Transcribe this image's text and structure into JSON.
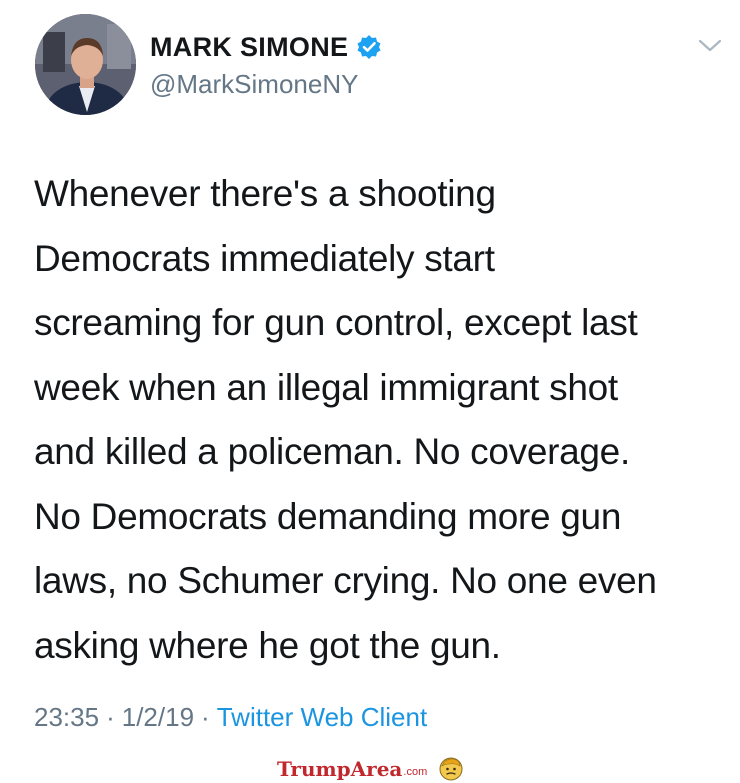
{
  "tweet": {
    "author_name": "MARK SIMONE",
    "handle": "@MarkSimoneNY",
    "text": "Whenever there's a shooting\nDemocrats immediately start\nscreaming for gun control, except last\nweek when an illegal immigrant shot\nand killed a policeman. No coverage.\nNo Democrats demanding more gun\nlaws, no Schumer crying. No one even\nasking where he got the gun.",
    "time": "23:35",
    "separator": "·",
    "date": "1/2/19",
    "client": "Twitter Web Client"
  },
  "watermark": {
    "brand": "TrumpArea",
    "tld": ".com"
  },
  "icons": {
    "verified": "verified-badge-icon",
    "more": "chevron-down-icon",
    "watermark_face": "trump-face-icon"
  },
  "colors": {
    "text": "#14171a",
    "secondary": "#657786",
    "link": "#1b95e0",
    "verified": "#1da1f2",
    "watermark": "#c0282d"
  }
}
